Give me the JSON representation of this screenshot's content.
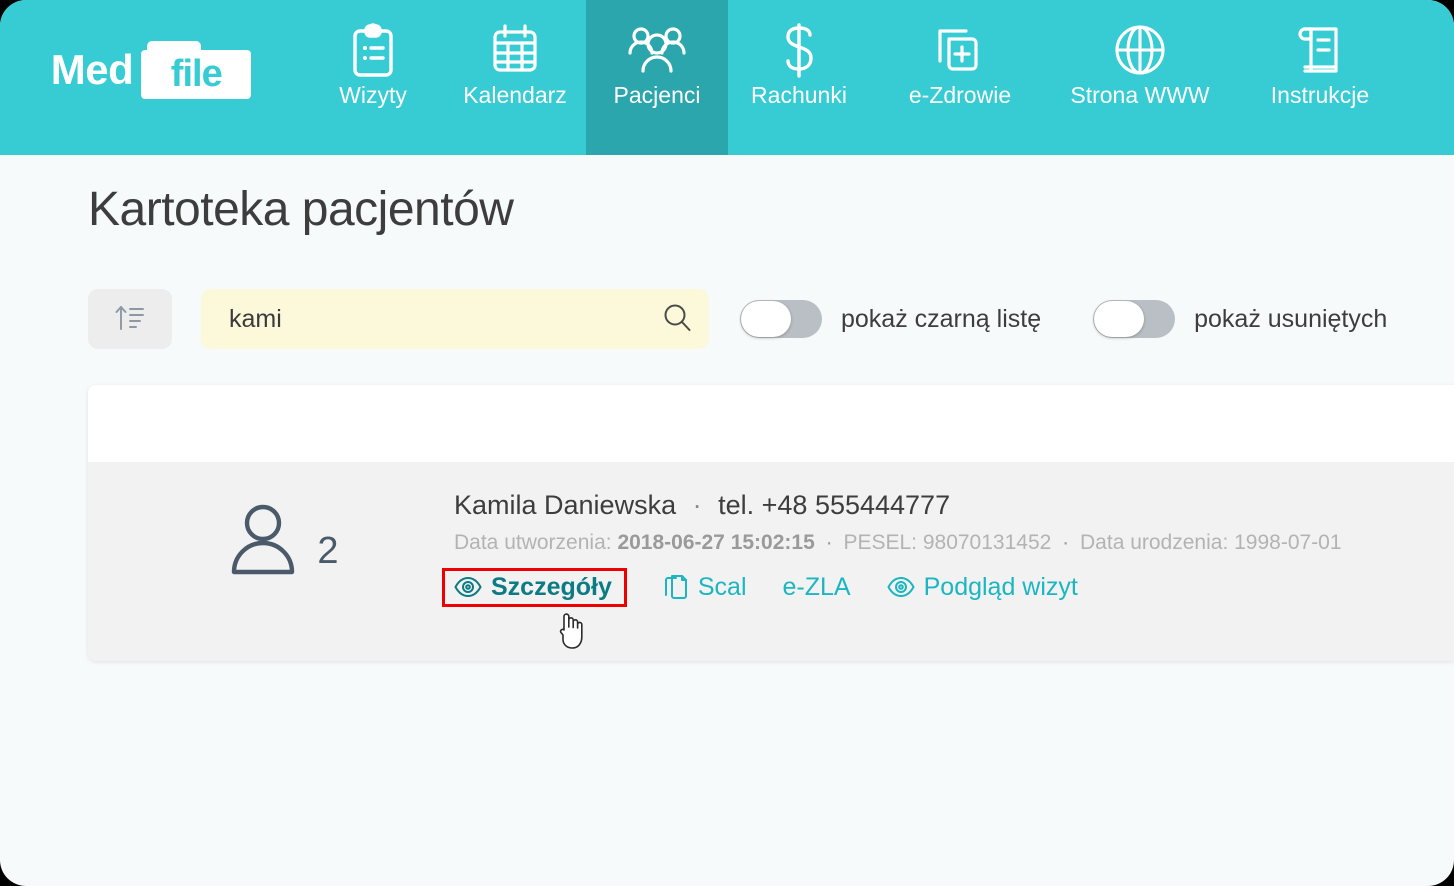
{
  "brand": {
    "word_one": "Med",
    "word_two": "file",
    "logo_icon": "folder-icon"
  },
  "nav": {
    "items": [
      {
        "label": "Wizyty",
        "icon": "clipboard-list-icon",
        "active": false
      },
      {
        "label": "Kalendarz",
        "icon": "calendar-icon",
        "active": false
      },
      {
        "label": "Pacjenci",
        "icon": "users-group-icon",
        "active": true
      },
      {
        "label": "Rachunki",
        "icon": "dollar-sign-icon",
        "active": false
      },
      {
        "label": "e-Zdrowie",
        "icon": "medical-files-icon",
        "active": false
      },
      {
        "label": "Strona WWW",
        "icon": "globe-icon",
        "active": false
      },
      {
        "label": "Instrukcje",
        "icon": "book-icon",
        "active": false
      }
    ],
    "header_color": "#37cbd3",
    "active_color": "#2ba6ad"
  },
  "page": {
    "title": "Kartoteka pacjentów"
  },
  "filters": {
    "sort_button": {
      "icon": "sort-ascending-icon"
    },
    "search": {
      "value": "kami",
      "placeholder": "",
      "icon": "search-icon"
    },
    "toggles": [
      {
        "label": "pokaż czarną listę",
        "on": false
      },
      {
        "label": "pokaż usuniętych",
        "on": false
      }
    ]
  },
  "results": {
    "patients": [
      {
        "avatar_icon": "person-icon",
        "count": "2",
        "name": "Kamila Daniewska",
        "separator": "·",
        "phone": "tel. +48 555444777",
        "meta": {
          "created_label": "Data utworzenia:",
          "created_value": "2018-06-27 15:02:15",
          "dot1": "·",
          "pesel_label": "PESEL:",
          "pesel_value": "98070131452",
          "dot2": "·",
          "birth_label": "Data urodzenia:",
          "birth_value": "1998-07-01"
        },
        "actions": [
          {
            "label": "Szczegóły",
            "icon": "eye-icon",
            "highlighted": true
          },
          {
            "label": "Scal",
            "icon": "copy-icon",
            "highlighted": false
          },
          {
            "label": "e-ZLA",
            "icon": "",
            "highlighted": false
          },
          {
            "label": "Podgląd wizyt",
            "icon": "eye-icon",
            "highlighted": false
          }
        ]
      }
    ]
  },
  "colors": {
    "accent_teal": "#37cbd3",
    "link_teal": "#1bb6c1",
    "link_teal_active": "#0d7b84",
    "highlight_red": "#ee0000",
    "search_yellow": "#fcf8da",
    "page_bg": "#f7fafb",
    "row_bg": "#f2f2f2"
  },
  "cursor": {
    "icon": "pointing-hand-cursor"
  }
}
